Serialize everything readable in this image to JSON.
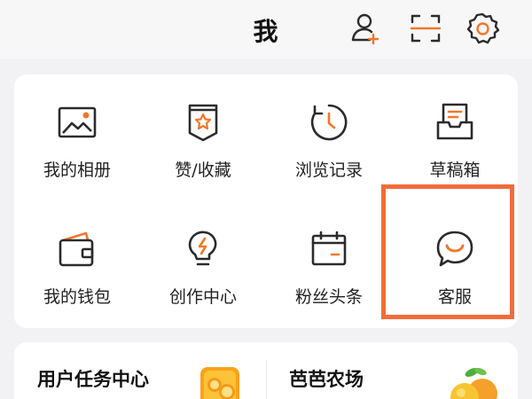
{
  "header": {
    "title": "我",
    "icons": [
      "add-friend-icon",
      "scan-icon",
      "settings-icon"
    ]
  },
  "grid": {
    "items": [
      {
        "label": "我的相册",
        "icon": "photo-album-icon"
      },
      {
        "label": "赞/收藏",
        "icon": "like-favorite-icon"
      },
      {
        "label": "浏览记录",
        "icon": "history-icon"
      },
      {
        "label": "草稿箱",
        "icon": "drafts-icon"
      },
      {
        "label": "我的钱包",
        "icon": "wallet-icon"
      },
      {
        "label": "创作中心",
        "icon": "creator-center-icon"
      },
      {
        "label": "粉丝头条",
        "icon": "fans-headline-icon"
      },
      {
        "label": "客服",
        "icon": "customer-service-icon"
      }
    ]
  },
  "promos": [
    {
      "title": "用户任务中心",
      "icon": "gold-coins-icon"
    },
    {
      "title": "芭芭农场",
      "icon": "fruit-icon"
    }
  ],
  "colors": {
    "accent": "#f26b3a",
    "icon_orange": "#f0782a",
    "icon_dark": "#2b2b2b"
  }
}
